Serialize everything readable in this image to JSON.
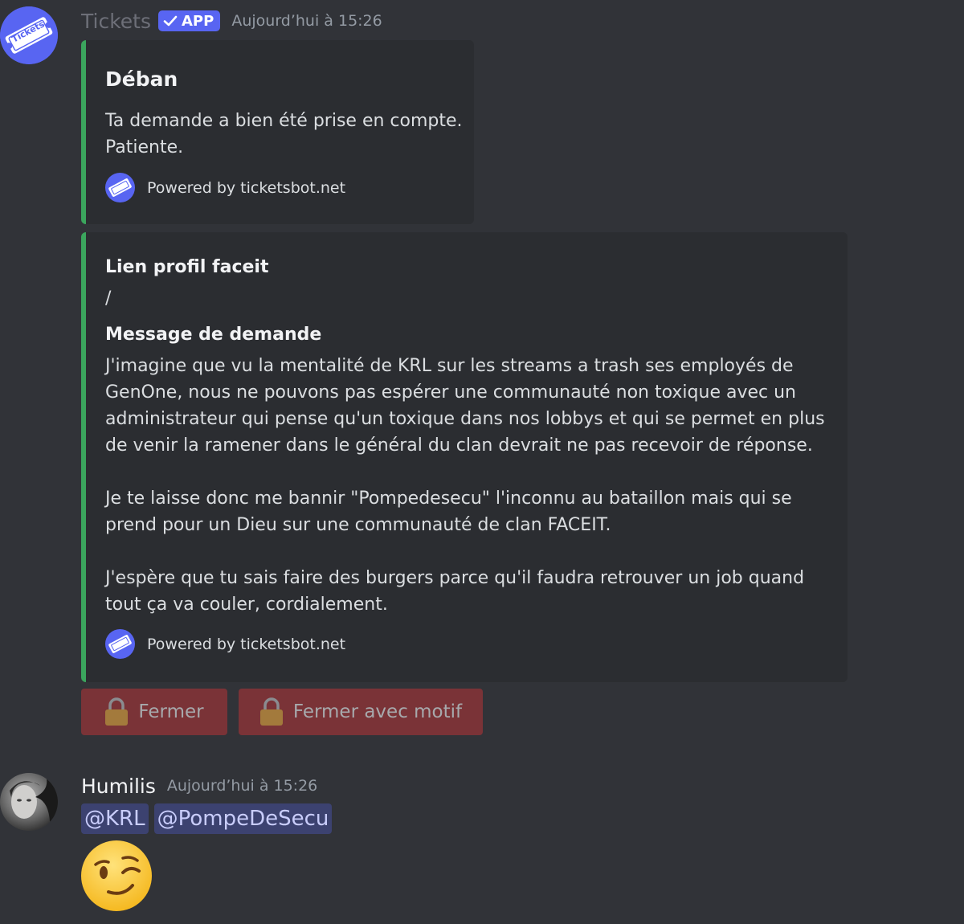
{
  "bot_message": {
    "username": "Tickets",
    "badge": "APP",
    "timestamp": "Aujourd’hui à 15:26",
    "avatar_text": "Tickets",
    "embeds": [
      {
        "title": "Déban",
        "description": [
          "Ta demande a bien été prise en compte.",
          "Patiente."
        ],
        "footer": "Powered by ticketsbot.net",
        "color": "#3ba55d"
      },
      {
        "fields": [
          {
            "name": "Lien profil faceit",
            "value": "/"
          },
          {
            "name": "Message de demande",
            "lines": [
              "J'imagine que vu la mentalité de KRL sur les streams a trash ses employés de",
              "GenOne, nous ne pouvons pas espérer une communauté non toxique avec un",
              "administrateur qui pense qu'un toxique dans nos lobbys et qui se permet en plus",
              "de venir la ramener dans le général du clan devrait ne pas recevoir de réponse.",
              "Je te laisse donc me bannir \"Pompedesecu\" l'inconnu au bataillon mais qui se",
              "prend pour un Dieu sur une communauté de clan FACEIT.",
              "J'espère que tu sais faire des burgers parce qu'il faudra retrouver un job quand",
              "tout ça va couler, cordialement."
            ]
          }
        ],
        "footer": "Powered by ticketsbot.net",
        "color": "#3ba55d"
      }
    ],
    "buttons": [
      {
        "label": "Fermer",
        "icon": "lock-icon"
      },
      {
        "label": "Fermer avec motif",
        "icon": "lock-icon"
      }
    ]
  },
  "user_message": {
    "username": "Humilis",
    "timestamp": "Aujourd’hui à 15:26",
    "mentions": [
      "@KRL",
      "@PompeDeSecu"
    ],
    "emoji": "wink-emoji"
  },
  "colors": {
    "background": "#313338",
    "embed_background": "#2b2d31",
    "embed_accent": "#3ba55d",
    "blurple": "#5865f2",
    "danger_button": "#7a3337",
    "mention_background": "#3c4270"
  }
}
